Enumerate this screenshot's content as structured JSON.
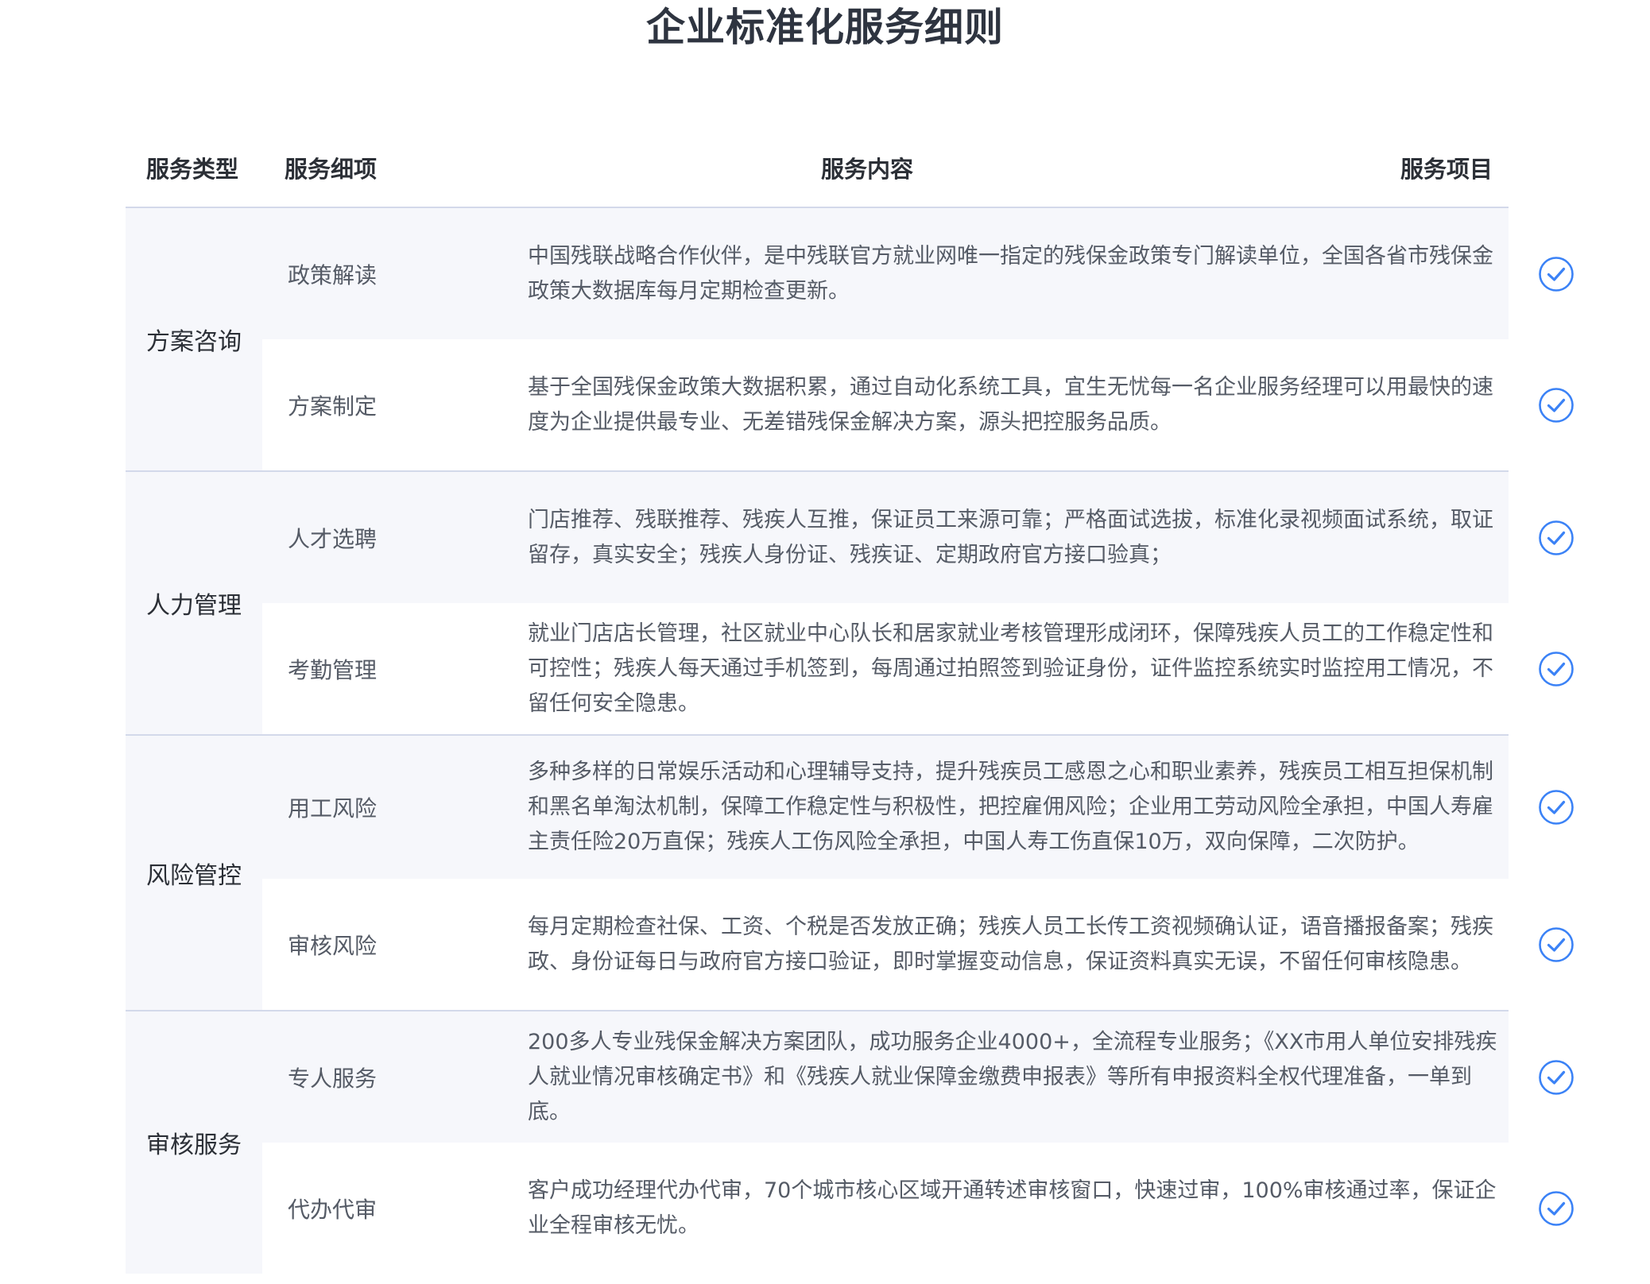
{
  "title": "企业标准化服务细则",
  "headers": {
    "type": "服务类型",
    "item": "服务细项",
    "content": "服务内容",
    "project": "服务项目"
  },
  "colors": {
    "accent": "#3b82f6",
    "shade": "#f6f7fb",
    "divider": "#d3d9ea"
  },
  "check_icon": "check-circle-icon",
  "groups": [
    {
      "type": "方案咨询",
      "rows": [
        {
          "item": "政策解读",
          "content": "中国残联战略合作伙伴，是中残联官方就业网唯一指定的残保金政策专门解读单位，全国各省市残保金政策大数据库每月定期检查更新。"
        },
        {
          "item": "方案制定",
          "content": "基于全国残保金政策大数据积累，通过自动化系统工具，宜生无忧每一名企业服务经理可以用最快的速度为企业提供最专业、无差错残保金解决方案，源头把控服务品质。"
        }
      ]
    },
    {
      "type": "人力管理",
      "rows": [
        {
          "item": "人才选聘",
          "content": "门店推荐、残联推荐、残疾人互推，保证员工来源可靠；严格面试选拔，标准化录视频面试系统，取证留存，真实安全；残疾人身份证、残疾证、定期政府官方接口验真；"
        },
        {
          "item": "考勤管理",
          "content": "就业门店店长管理，社区就业中心队长和居家就业考核管理形成闭环，保障残疾人员工的工作稳定性和可控性；残疾人每天通过手机签到，每周通过拍照签到验证身份，证件监控系统实时监控用工情况，不留任何安全隐患。"
        }
      ]
    },
    {
      "type": "风险管控",
      "rows": [
        {
          "item": "用工风险",
          "content": "多种多样的日常娱乐活动和心理辅导支持，提升残疾员工感恩之心和职业素养，残疾员工相互担保机制和黑名单淘汰机制，保障工作稳定性与积极性，把控雇佣风险；企业用工劳动风险全承担，中国人寿雇主责任险20万直保；残疾人工伤风险全承担，中国人寿工伤直保10万，双向保障，二次防护。"
        },
        {
          "item": "审核风险",
          "content": "每月定期检查社保、工资、个税是否发放正确；残疾人员工长传工资视频确认证，语音播报备案；残疾政、身份证每日与政府官方接口验证，即时掌握变动信息，保证资料真实无误，不留任何审核隐患。"
        }
      ]
    },
    {
      "type": "审核服务",
      "rows": [
        {
          "item": "专人服务",
          "content": "200多人专业残保金解决方案团队，成功服务企业4000+，全流程专业服务；《XX市用人单位安排残疾人就业情况审核确定书》和《残疾人就业保障金缴费申报表》等所有申报资料全权代理准备，一单到底。"
        },
        {
          "item": "代办代审",
          "content": "客户成功经理代办代审，70个城市核心区域开通转述审核窗口，快速过审，100%审核通过率，保证企业全程审核无忧。"
        }
      ]
    }
  ]
}
